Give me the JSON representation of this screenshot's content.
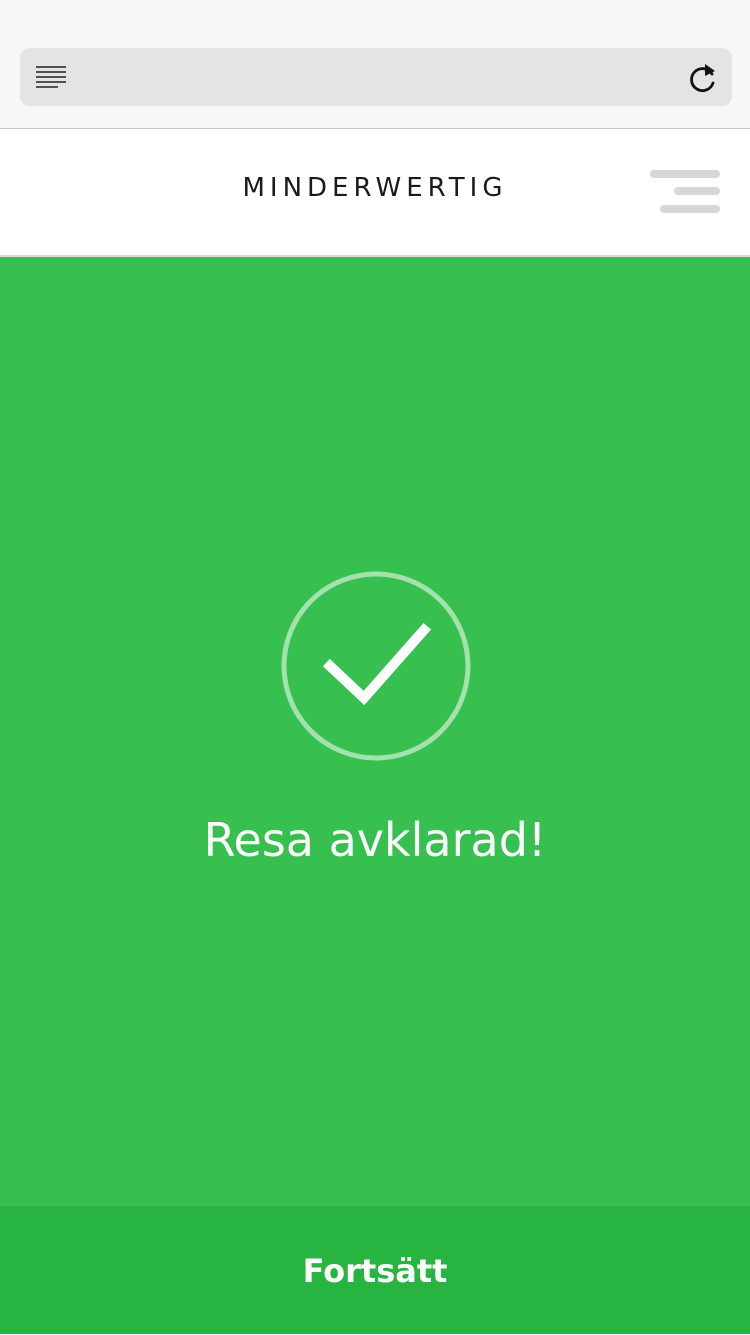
{
  "browser": {
    "reader_icon": "reader-view-icon",
    "reload_icon": "reload-icon"
  },
  "header": {
    "brand": "MINDERWERTIG",
    "menu_icon": "hamburger-menu-icon"
  },
  "confirmation": {
    "icon": "checkmark-circle-icon",
    "message": "Resa avklarad!"
  },
  "footer": {
    "continue_label": "Fortsätt"
  },
  "colors": {
    "success_green": "#37c04f",
    "button_green": "#28b440",
    "header_bg": "#ffffff",
    "chrome_bg": "#f7f7f7"
  }
}
